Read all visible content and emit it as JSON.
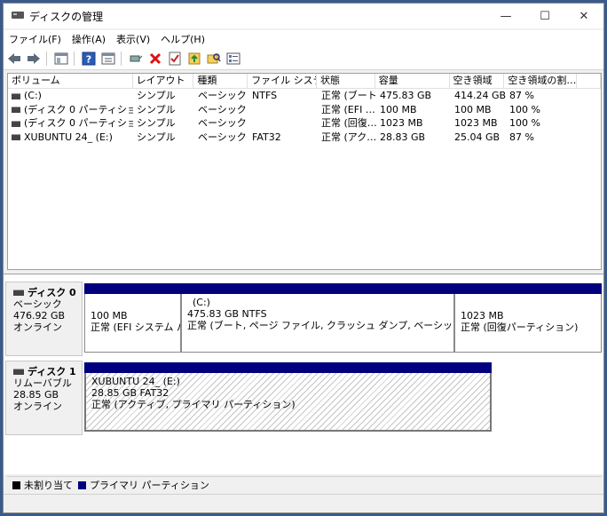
{
  "window": {
    "title": "ディスクの管理",
    "controls": [
      "—",
      "☐",
      "✕"
    ]
  },
  "menu": [
    "ファイル(F)",
    "操作(A)",
    "表示(V)",
    "ヘルプ(H)"
  ],
  "volumes": {
    "columns": [
      "ボリューム",
      "レイアウト",
      "種類",
      "ファイル システム",
      "状態",
      "容量",
      "空き領域",
      "空き領域の割…"
    ],
    "rows": [
      [
        "(C:)",
        "シンプル",
        "ベーシック",
        "NTFS",
        "正常 (ブート…",
        "475.83 GB",
        "414.24 GB",
        "87 %"
      ],
      [
        "(ディスク 0 パーティション 1)",
        "シンプル",
        "ベーシック",
        "",
        "正常 (EFI …",
        "100 MB",
        "100 MB",
        "100 %"
      ],
      [
        "(ディスク 0 パーティション 4)",
        "シンプル",
        "ベーシック",
        "",
        "正常 (回復…",
        "1023 MB",
        "1023 MB",
        "100 %"
      ],
      [
        "XUBUNTU 24_ (E:)",
        "シンプル",
        "ベーシック",
        "FAT32",
        "正常 (アク…",
        "28.83 GB",
        "25.04 GB",
        "87 %"
      ]
    ]
  },
  "disks": [
    {
      "name": "ディスク 0",
      "type": "ベーシック",
      "size": "476.92 GB",
      "status": "オンライン",
      "partitions": [
        {
          "title": "",
          "size": "100 MB",
          "status": "正常 (EFI システム パー"
        },
        {
          "title": "(C:)",
          "size": "475.83 GB NTFS",
          "status": "正常 (ブート, ページ ファイル, クラッシュ ダンプ, ベーシック データ パーティ"
        },
        {
          "title": "",
          "size": "1023 MB",
          "status": "正常 (回復パーティション)"
        }
      ]
    },
    {
      "name": "ディスク 1",
      "type": "リムーバブル",
      "size": "28.85 GB",
      "status": "オンライン",
      "partitions": [
        {
          "title": "XUBUNTU 24_ (E:)",
          "size": "28.85 GB FAT32",
          "status": "正常 (アクティブ, プライマリ パーティション)"
        }
      ]
    }
  ],
  "legend": [
    {
      "label": "未割り当て",
      "color": "#000000"
    },
    {
      "label": "プライマリ パーティション",
      "color": "#00007f"
    }
  ],
  "colors": {
    "partition_header": "#00007f"
  }
}
